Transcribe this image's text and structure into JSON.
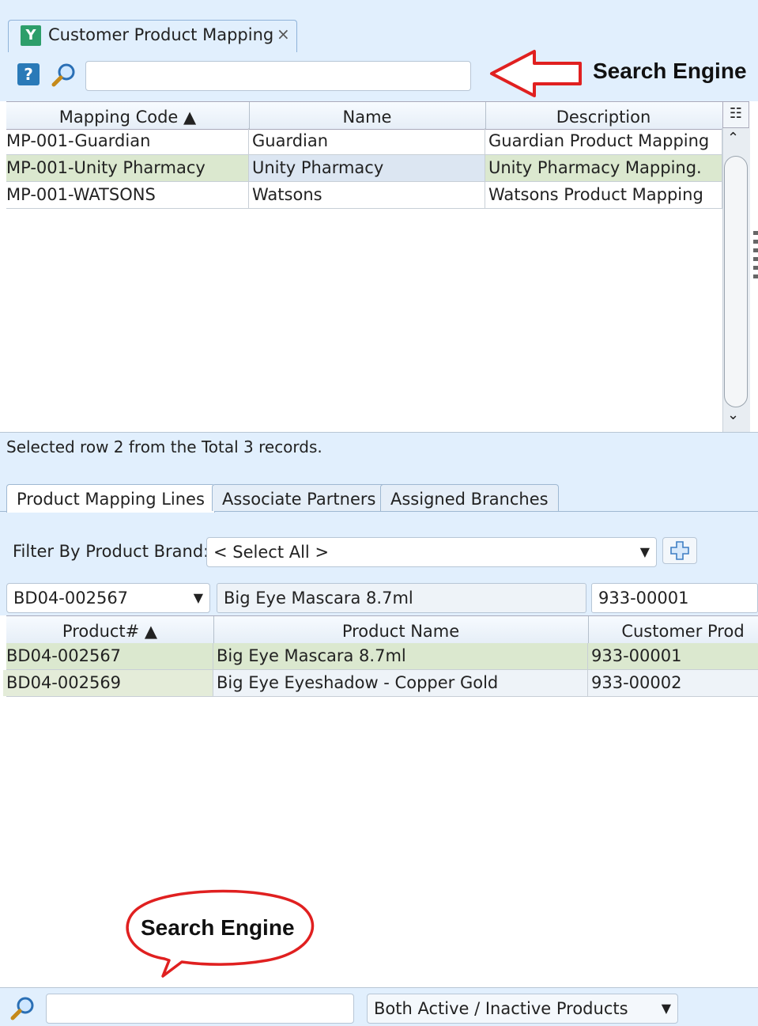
{
  "window": {
    "tab_title": "Customer Product Mapping",
    "tab_close": "×"
  },
  "toolbar": {
    "help_label": "?",
    "search_value": ""
  },
  "annotations": {
    "top_label": "Search Engine",
    "bottom_label": "Search Engine"
  },
  "mapping_grid": {
    "columns": [
      "Mapping Code ▲",
      "Name",
      "Description"
    ],
    "rows": [
      {
        "code": "MP-001-Guardian",
        "name": "Guardian",
        "description": "Guardian Product Mapping"
      },
      {
        "code": "MP-001-Unity Pharmacy",
        "name": "Unity Pharmacy",
        "description": "Unity Pharmacy Mapping."
      },
      {
        "code": "MP-001-WATSONS",
        "name": "Watsons",
        "description": "Watsons Product Mapping"
      }
    ],
    "status": "Selected row 2 from the Total 3 records."
  },
  "sub_tabs": [
    "Product Mapping Lines",
    "Associate Partners",
    "Assigned Branches"
  ],
  "filter": {
    "label": "Filter By Product Brand:",
    "selected": "< Select All >"
  },
  "editor": {
    "product_code": "BD04-002567",
    "product_name": "Big Eye Mascara 8.7ml",
    "customer_code": "933-00001"
  },
  "lines_grid": {
    "columns": [
      "Product# ▲",
      "Product Name",
      "Customer Prod"
    ],
    "rows": [
      {
        "product": "BD04-002567",
        "name": "Big Eye Mascara 8.7ml",
        "customer": "933-00001"
      },
      {
        "product": "BD04-002569",
        "name": "Big Eye Eyeshadow - Copper Gold",
        "customer": "933-00002"
      }
    ]
  },
  "bottom_bar": {
    "search_value": "",
    "status_filter": "Both Active / Inactive Products"
  },
  "colors": {
    "panel_bg": "#e1effd",
    "selected_row": "#dbe8cf",
    "annotation_red": "#e02020"
  }
}
